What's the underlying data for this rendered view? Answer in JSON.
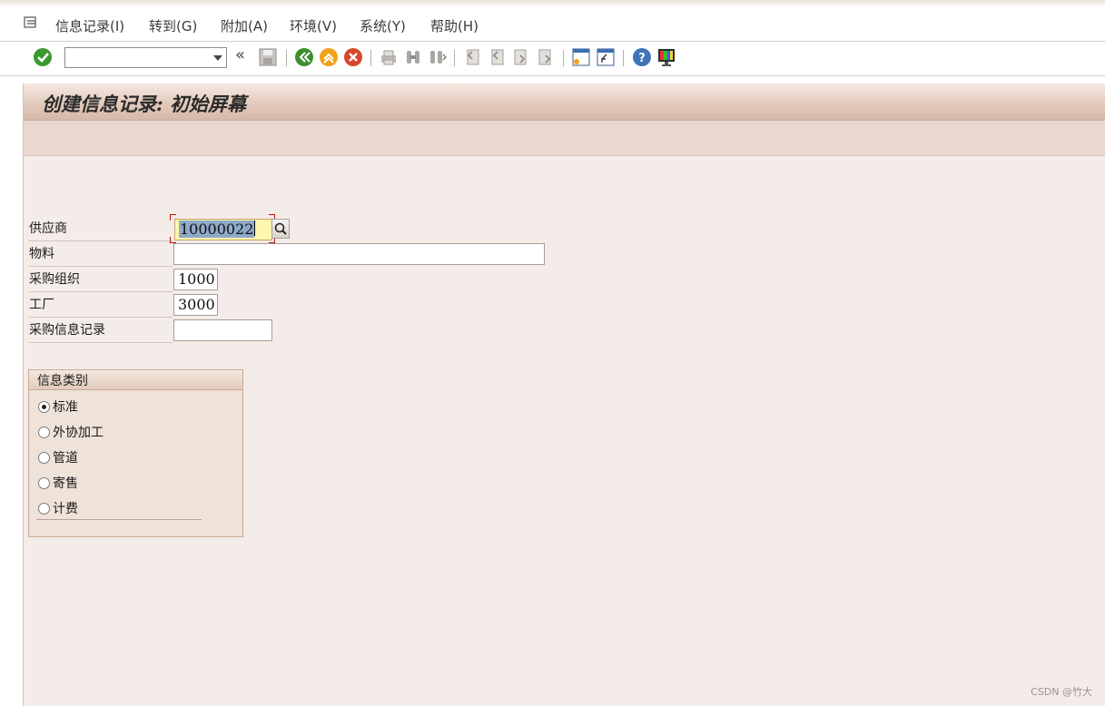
{
  "menubar": {
    "items": [
      "信息记录(I)",
      "转到(G)",
      "附加(A)",
      "环境(V)",
      "系统(Y)",
      "帮助(H)"
    ]
  },
  "toolbar": {
    "command_field_value": "",
    "icons": [
      "enter-icon",
      "command-dropdown-icon",
      "collapse-icon",
      "save-icon",
      "back-icon",
      "exit-icon",
      "cancel-icon",
      "print-icon",
      "find-icon",
      "find-next-icon",
      "first-page-icon",
      "previous-page-icon",
      "next-page-icon",
      "last-page-icon",
      "new-session-icon",
      "shortcut-icon",
      "help-icon",
      "customize-layout-icon"
    ]
  },
  "title": {
    "text": "创建信息记录: 初始屏幕"
  },
  "form": {
    "vendor_label": "供应商",
    "vendor_value": "10000022",
    "material_label": "物料",
    "material_value": "",
    "purch_org_label": "采购组织",
    "purch_org_value": "1000",
    "plant_label": "工厂",
    "plant_value": "3000",
    "info_record_label": "采购信息记录",
    "info_record_value": ""
  },
  "info_category": {
    "title": "信息类别",
    "options": [
      "标准",
      "外协加工",
      "管道",
      "寄售",
      "计费"
    ],
    "selected": "标准"
  },
  "watermark": "CSDN @竹大",
  "colors": {
    "background": "#f4ece8",
    "title_bar": "#e3cbbd",
    "active_field": "#fdf6ad",
    "selection": "#8fa9c8"
  }
}
